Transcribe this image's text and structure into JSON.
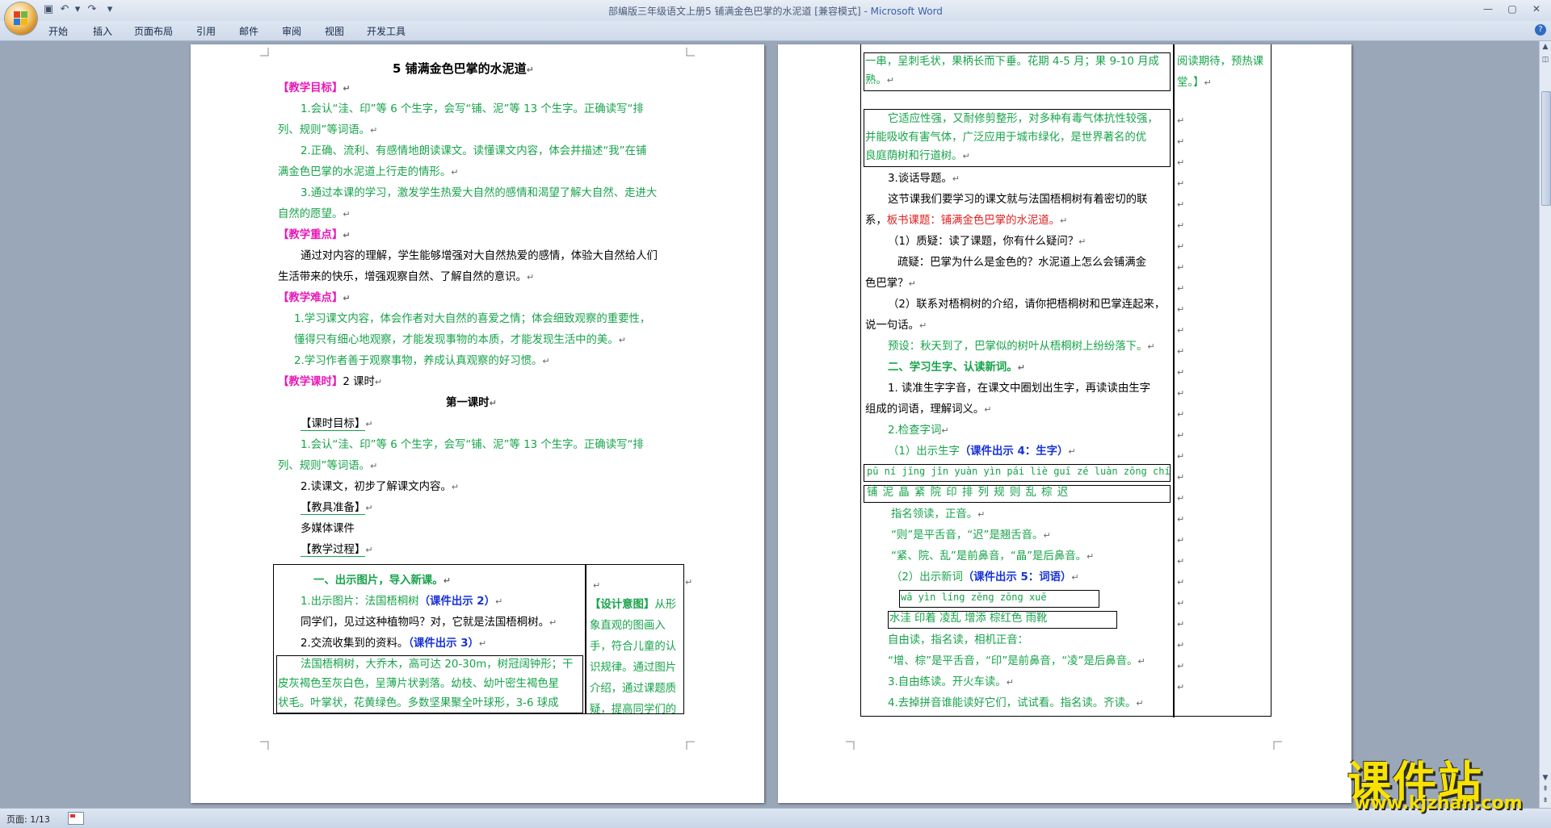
{
  "window": {
    "title": "部编版三年级语文上册5 铺满金色巴掌的水泥道 [兼容模式]",
    "app_name": "Microsoft Word",
    "separator": " - "
  },
  "ribbon": {
    "tabs": [
      {
        "label": "开始"
      },
      {
        "label": "插入"
      },
      {
        "label": "页面布局"
      },
      {
        "label": "引用"
      },
      {
        "label": "邮件"
      },
      {
        "label": "审阅"
      },
      {
        "label": "视图"
      },
      {
        "label": "开发工具"
      }
    ]
  },
  "status": {
    "page": "页面: 1/13"
  },
  "watermark": {
    "text": "课件站",
    "url": "www.kjzhan.com"
  },
  "colors": {
    "magenta": "#e619b5",
    "green": "#17a34a",
    "blue": "#1733d6",
    "red": "#e02020"
  },
  "page1": {
    "title": "5  铺满金色巴掌的水泥道",
    "goal_head": "【教学目标】",
    "goal1a": "1.会认“洼、印”等 6 个生字，会写“铺、泥”等 13 个生字。正确读写“排",
    "goal1b": "列、规则”等词语。",
    "goal2a": "2.正确、流利、有感情地朗读课文。读懂课文内容，体会并描述“我”在铺",
    "goal2b": "满金色巴掌的水泥道上行走的情形。",
    "goal3a": "3.通过本课的学习，激发学生热爱大自然的感情和渴望了解大自然、走进大",
    "goal3b": "自然的愿望。",
    "key_head": "【教学重点】",
    "key1a": "通过对内容的理解，学生能够增强对大自然热爱的感情，体验大自然给人们",
    "key1b": "生活带来的快乐，增强观察自然、了解自然的意识。",
    "diff_head": "【教学难点】",
    "diff1a": "1.学习课文内容，体会作者对大自然的喜爱之情；体会细致观察的重要性，",
    "diff1b": "懂得只有细心地观察，才能发现事物的本质，才能发现生活中的美。",
    "diff2": "2.学习作者善于观察事物，养成认真观察的好习惯。",
    "hours_head": "【教学课时】",
    "hours_val": "2 课时",
    "lesson1": "第一课时",
    "lgoal_head": "【课时目标】",
    "lgoal1a": "1.会认“洼、印”等 6 个生字，会写“铺、泥”等 13 个生字。正确读写“排",
    "lgoal1b": "列、规则”等词语。",
    "lgoal2": "2.读课文，初步了解课文内容。",
    "prep_head": "【教具准备】",
    "prep_val": "多媒体课件",
    "proc_head": "【教学过程】",
    "t1": "一、出示图片，导入新课。",
    "t2a": "1.出示图片：法国梧桐树",
    "t2b": "（课件出示 2）",
    "t3": "同学们，见过这种植物吗？对，它就是法国梧桐树。",
    "t4a": "2.交流收集到的资料。",
    "t4b": "（课件出示 3）",
    "t5": "法国梧桐树，大乔木，高可达 20-30m，树冠阔钟形；干",
    "t6": "皮灰褐色至灰白色，呈薄片状剥落。幼枝、幼叶密生褐色星",
    "t7": "状毛。叶掌状，花黄绿色。多数坚果聚全叶球形，3-6 球成",
    "side_head": "【设计意图】",
    "side1": "从形",
    "side2": "象直观的图画入",
    "side3": "手，符合儿童的认",
    "side4": "识规律。通过图片",
    "side5": "介绍，通过课题质",
    "side6": "疑，提高同学们的"
  },
  "page2": {
    "l1": "一串，呈刺毛状，果柄长而下垂。花期 4-5 月；果 9-10 月成",
    "l2": "熟。",
    "l3": "它适应性强，又耐修剪整形，对多种有毒气体抗性较强，",
    "l4": "并能吸收有害气体，广泛应用于城市绿化，是世界著名的优",
    "l5": "良庭荫树和行道树。",
    "l6": "3.谈话导题。",
    "l7": "这节课我们要学习的课文就与法国梧桐树有着密切的联",
    "l8a": "系，",
    "l8b": "板书课题：铺满金色巴掌的水泥道。",
    "l9": "（1）质疑：读了课题，你有什么疑问？",
    "l10": "疏疑：巴掌为什么是金色的？水泥道上怎么会铺满金",
    "l11": "色巴掌？",
    "l12": "（2）联系对梧桐树的介绍，请你把梧桐树和巴掌连起来，",
    "l13": "说一句话。",
    "l14": "预设：秋天到了，巴掌似的树叶从梧桐树上纷纷落下。",
    "l15": "二、学习生字、认读新词。",
    "l16": "1. 读准生字字音，在课文中圈划出生字，再读读由生字",
    "l17": "组成的词语，理解词义。",
    "l18": "2.检查字词",
    "l19a": "（1）出示生字",
    "l19b": "（课件出示 4：生字）",
    "pinyin1": "pū  ní  jīng  jǐn  yuàn  yìn  pái  liè  guī  zé  luàn  zōng  chí",
    "chars1": "铺  泥  晶  紧   院  印  排  列  规  则  乱   棕  迟",
    "l20": "指名领读，正音。",
    "l21": "“则”是平舌音，“迟”是翘舌音。",
    "l22": "“紧、院、乱”是前鼻音，“晶”是后鼻音。",
    "l23a": "（2）出示新词",
    "l23b": "（课件出示 5：词语）",
    "pinyin2": "wā  yìn  líng  zēng  zōng       xuē",
    "chars2": "水洼  印着   凌乱   增添  棕红色   雨靴",
    "l24": "自由读，指名读，相机正音：",
    "l25": "“增、棕”是平舌音，“印”是前鼻音，“凌”是后鼻音。",
    "l26": "3.自由练读。开火车读。",
    "l27": "4.去掉拼音谁能读好它们，试试看。指名读。齐读。",
    "side1": "阅读期待，预热课",
    "side2": "堂。】"
  }
}
